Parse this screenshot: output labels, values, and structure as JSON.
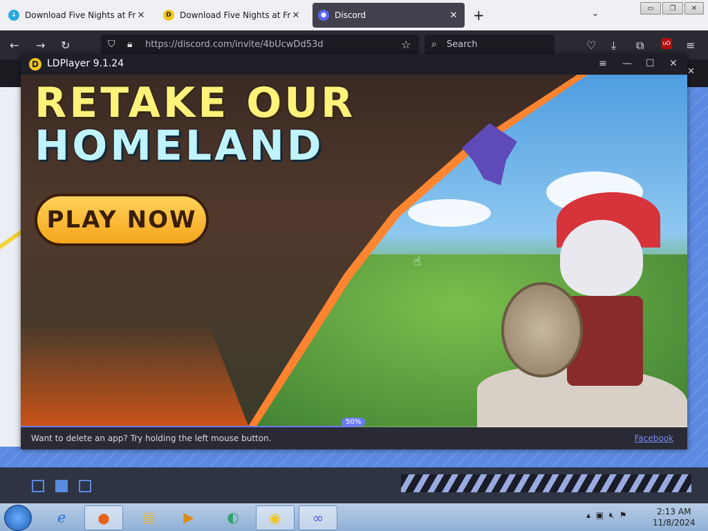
{
  "browser": {
    "tabs": [
      {
        "title": "Download Five Nights at Freddy's",
        "active": false
      },
      {
        "title": "Download Five Nights at Freddy's",
        "active": false
      },
      {
        "title": "Discord",
        "active": true
      }
    ],
    "url": "https://discord.com/invite/4bUcwDd53d",
    "search_placeholder": "Search"
  },
  "ldplayer": {
    "title": "LDPlayer 9.1.24",
    "ad": {
      "headline_line1": "RETAKE OUR",
      "headline_line2": "HOMELAND",
      "cta": "PLAY NOW"
    },
    "progress_percent": 50,
    "progress_label": "50%",
    "tip": "Want to delete an app? Try holding the left mouse button.",
    "link": "Facebook"
  },
  "taskbar": {
    "time": "2:13 AM",
    "date": "11/8/2024"
  },
  "colors": {
    "accent": "#6a7df5",
    "ld_logo": "#f4c51b",
    "tab_active": "#42414d"
  }
}
